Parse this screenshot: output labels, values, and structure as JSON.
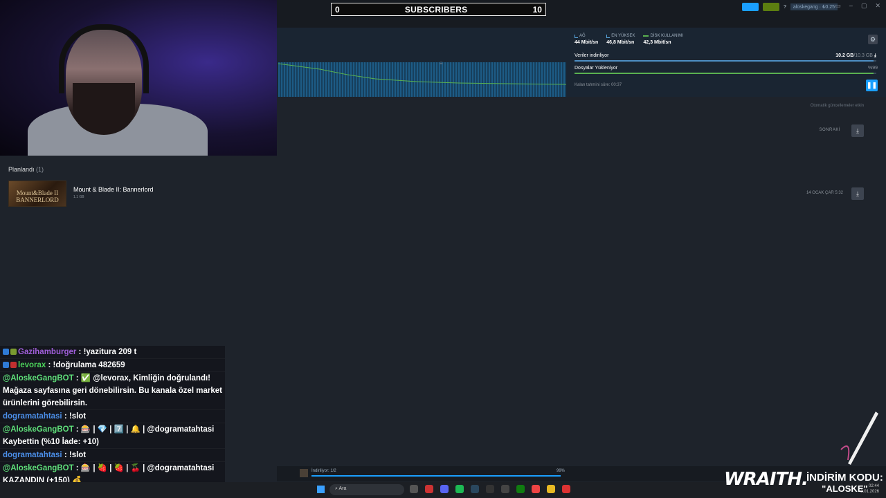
{
  "overlay": {
    "subscribers": {
      "left": "0",
      "title": "SUBSCRIBERS",
      "right": "10"
    }
  },
  "steam": {
    "account": {
      "user": "aloskegang",
      "balance": "₺0.25"
    },
    "stats": [
      {
        "label": "AĞ",
        "value": "44 Mbit/sn"
      },
      {
        "label": "EN YÜKSEK",
        "value": "46,8 Mbit/sn"
      },
      {
        "label": "DİSK KULLANIMI",
        "value": "42,3 Mbit/sn"
      }
    ],
    "download": {
      "data_label": "Veriler indiriliyor",
      "data_done": "10.2 GB",
      "data_total": "/10.3 GB",
      "data_progress": 0.99,
      "files_label": "Dosyalar Yükleniyor",
      "files_pct": "%99",
      "files_progress": 0.99,
      "eta": "Kalan tahmini süre: 00:37"
    },
    "auto_updates": "Otomatik güncellemeler etkin",
    "next_label": "SONRAKİ",
    "section_title": "Planlandı",
    "section_count": "(1)",
    "game": {
      "logo_line1": "Mount&Blade II",
      "logo_line2": "BANNERLORD",
      "title": "Mount & Blade II: Bannerlord",
      "size": "1.1 GB",
      "scheduled": "14 OCAK ÇAR 5:32"
    },
    "bottom": {
      "status": "İndiriliyor: 1/2",
      "pct": "99%",
      "progress": 0.99
    }
  },
  "chat": [
    {
      "user": "Gazihamburger",
      "text": " : !yazitura 209 t",
      "color": "purple"
    },
    {
      "user": "levorax",
      "text": " : !doğrulama 482659",
      "color": "green"
    },
    {
      "user": "@AloskeGangBOT",
      "text": " : ✅ @levorax, Kimliğin doğrulandı! Mağaza sayfasına geri dönebilirsin. Bu kanala özel market ürünlerini görebilirsin.",
      "color": "bot"
    },
    {
      "user": "dogramatahtasi",
      "text": " : !slot",
      "color": "blue"
    },
    {
      "user": "@AloskeGangBOT",
      "text": " : 🎰 | 💎 | 7️⃣ | 🔔 | @dogramatahtasi Kaybettin (%10 İade: +10)",
      "color": "bot"
    },
    {
      "user": "dogramatahtasi",
      "text": " : !slot",
      "color": "blue"
    },
    {
      "user": "@AloskeGangBOT",
      "text": " : 🎰 | 🍓 | 🍓 | 🍒 | @dogramatahtasi KAZANDIN (+150) 💰",
      "color": "bot"
    }
  ],
  "taskbar": {
    "search_placeholder": "Ara",
    "time": "02:44",
    "date": "2.01.2026"
  },
  "sponsor": {
    "brand": "WRAITH.",
    "promo_label": "İNDİRİM KODU:",
    "promo_code": "\"ALOSKE\""
  }
}
